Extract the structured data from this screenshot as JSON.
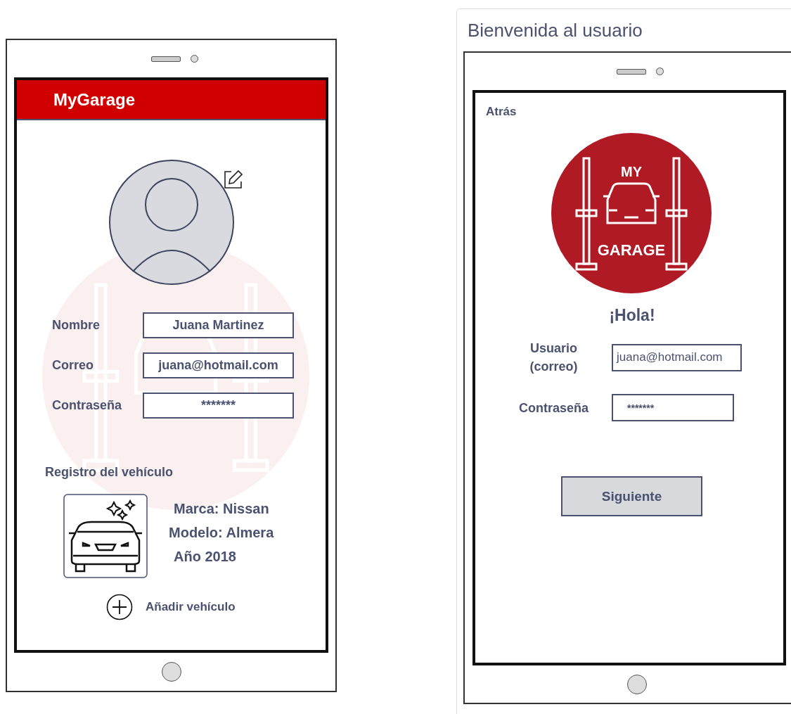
{
  "profile_screen": {
    "app_title": "MyGarage",
    "fields": [
      {
        "label": "Nombre",
        "value": "Juana Martinez"
      },
      {
        "label": "Correo",
        "value": "juana@hotmail.com"
      },
      {
        "label": "Contraseña",
        "value": "*******"
      }
    ],
    "section_title": "Registro del vehículo",
    "vehicle_lines": [
      "Marca: Nissan",
      "Modelo: Almera",
      "Año 2018"
    ],
    "add_button": "Añadir vehículo"
  },
  "login_panel": {
    "title": "Bienvenida al usuario",
    "back_link": "Atrás",
    "logo": {
      "top": "MY",
      "bottom": "GARAGE"
    },
    "greeting": "¡Hola!",
    "fields": [
      {
        "label": "Usuario (correo)",
        "value": "juana@hotmail.com"
      },
      {
        "label": "Contraseña",
        "value": "*******"
      }
    ],
    "next_button": "Siguiente"
  }
}
